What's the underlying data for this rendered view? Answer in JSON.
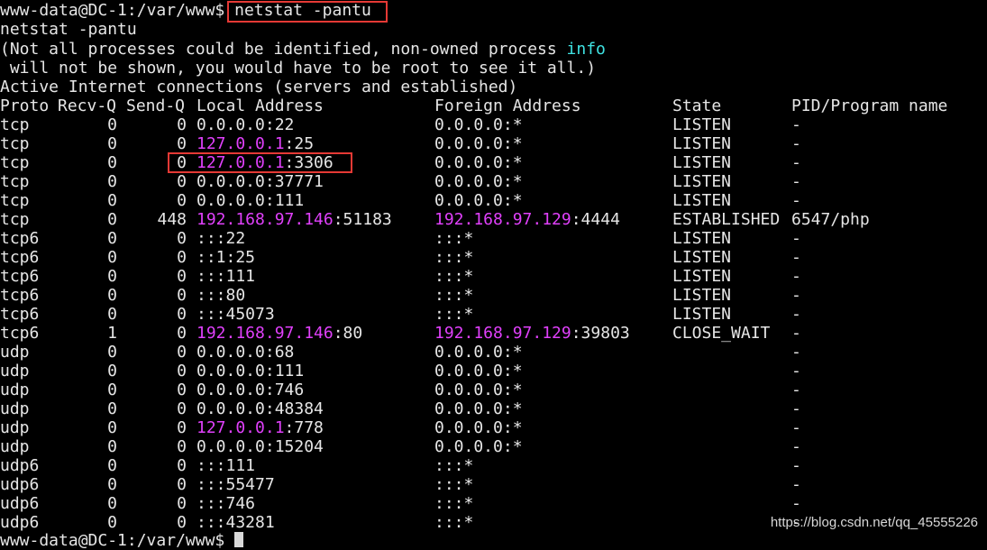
{
  "prompt": {
    "user_host": "www-data@DC-1",
    "path_sep": ":/var/www$",
    "command": "netstat -pantu"
  },
  "echo": "netstat -pantu",
  "notice": {
    "line1_pre": "(Not all processes could be identified, non-owned process ",
    "line1_kw": "info",
    "line2": " will not be shown, you would have to be root to see it all.)"
  },
  "section_title": "Active Internet connections (servers and established)",
  "headers": {
    "proto": "Proto",
    "recvq": "Recv-Q",
    "sendq": "Send-Q",
    "local": "Local Address",
    "foreign": "Foreign Address",
    "state": "State",
    "pid": "PID/Program name"
  },
  "rows": [
    {
      "proto": "tcp",
      "recvq": "0",
      "sendq": "0",
      "local_ip": "0.0.0.0",
      "local_port": ":22",
      "local_colored": false,
      "foreign_ip": "0.0.0.0",
      "foreign_port": ":*",
      "foreign_colored": false,
      "state": "LISTEN",
      "pid": "-"
    },
    {
      "proto": "tcp",
      "recvq": "0",
      "sendq": "0",
      "local_ip": "127.0.0.1",
      "local_port": ":25",
      "local_colored": true,
      "foreign_ip": "0.0.0.0",
      "foreign_port": ":*",
      "foreign_colored": false,
      "state": "LISTEN",
      "pid": "-"
    },
    {
      "proto": "tcp",
      "recvq": "0",
      "sendq": "0",
      "local_ip": "127.0.0.1",
      "local_port": ":3306",
      "local_colored": true,
      "foreign_ip": "0.0.0.0",
      "foreign_port": ":*",
      "foreign_colored": false,
      "state": "LISTEN",
      "pid": "-"
    },
    {
      "proto": "tcp",
      "recvq": "0",
      "sendq": "0",
      "local_ip": "0.0.0.0",
      "local_port": ":37771",
      "local_colored": false,
      "foreign_ip": "0.0.0.0",
      "foreign_port": ":*",
      "foreign_colored": false,
      "state": "LISTEN",
      "pid": "-"
    },
    {
      "proto": "tcp",
      "recvq": "0",
      "sendq": "0",
      "local_ip": "0.0.0.0",
      "local_port": ":111",
      "local_colored": false,
      "foreign_ip": "0.0.0.0",
      "foreign_port": ":*",
      "foreign_colored": false,
      "state": "LISTEN",
      "pid": "-"
    },
    {
      "proto": "tcp",
      "recvq": "0",
      "sendq": "448",
      "local_ip": "192.168.97.146",
      "local_port": ":51183",
      "local_colored": true,
      "foreign_ip": "192.168.97.129",
      "foreign_port": ":4444",
      "foreign_colored": true,
      "state": "ESTABLISHED",
      "pid": "6547/php"
    },
    {
      "proto": "tcp6",
      "recvq": "0",
      "sendq": "0",
      "local_ip": ":::22",
      "local_port": "",
      "local_colored": false,
      "foreign_ip": ":::*",
      "foreign_port": "",
      "foreign_colored": false,
      "state": "LISTEN",
      "pid": "-"
    },
    {
      "proto": "tcp6",
      "recvq": "0",
      "sendq": "0",
      "local_ip": "::1:25",
      "local_port": "",
      "local_colored": false,
      "foreign_ip": ":::*",
      "foreign_port": "",
      "foreign_colored": false,
      "state": "LISTEN",
      "pid": "-"
    },
    {
      "proto": "tcp6",
      "recvq": "0",
      "sendq": "0",
      "local_ip": ":::111",
      "local_port": "",
      "local_colored": false,
      "foreign_ip": ":::*",
      "foreign_port": "",
      "foreign_colored": false,
      "state": "LISTEN",
      "pid": "-"
    },
    {
      "proto": "tcp6",
      "recvq": "0",
      "sendq": "0",
      "local_ip": ":::80",
      "local_port": "",
      "local_colored": false,
      "foreign_ip": ":::*",
      "foreign_port": "",
      "foreign_colored": false,
      "state": "LISTEN",
      "pid": "-"
    },
    {
      "proto": "tcp6",
      "recvq": "0",
      "sendq": "0",
      "local_ip": ":::45073",
      "local_port": "",
      "local_colored": false,
      "foreign_ip": ":::*",
      "foreign_port": "",
      "foreign_colored": false,
      "state": "LISTEN",
      "pid": "-"
    },
    {
      "proto": "tcp6",
      "recvq": "1",
      "sendq": "0",
      "local_ip": "192.168.97.146",
      "local_port": ":80",
      "local_colored": true,
      "foreign_ip": "192.168.97.129",
      "foreign_port": ":39803",
      "foreign_colored": true,
      "state": "CLOSE_WAIT",
      "pid": "-"
    },
    {
      "proto": "udp",
      "recvq": "0",
      "sendq": "0",
      "local_ip": "0.0.0.0",
      "local_port": ":68",
      "local_colored": false,
      "foreign_ip": "0.0.0.0",
      "foreign_port": ":*",
      "foreign_colored": false,
      "state": "",
      "pid": "-"
    },
    {
      "proto": "udp",
      "recvq": "0",
      "sendq": "0",
      "local_ip": "0.0.0.0",
      "local_port": ":111",
      "local_colored": false,
      "foreign_ip": "0.0.0.0",
      "foreign_port": ":*",
      "foreign_colored": false,
      "state": "",
      "pid": "-"
    },
    {
      "proto": "udp",
      "recvq": "0",
      "sendq": "0",
      "local_ip": "0.0.0.0",
      "local_port": ":746",
      "local_colored": false,
      "foreign_ip": "0.0.0.0",
      "foreign_port": ":*",
      "foreign_colored": false,
      "state": "",
      "pid": "-"
    },
    {
      "proto": "udp",
      "recvq": "0",
      "sendq": "0",
      "local_ip": "0.0.0.0",
      "local_port": ":48384",
      "local_colored": false,
      "foreign_ip": "0.0.0.0",
      "foreign_port": ":*",
      "foreign_colored": false,
      "state": "",
      "pid": "-"
    },
    {
      "proto": "udp",
      "recvq": "0",
      "sendq": "0",
      "local_ip": "127.0.0.1",
      "local_port": ":778",
      "local_colored": true,
      "foreign_ip": "0.0.0.0",
      "foreign_port": ":*",
      "foreign_colored": false,
      "state": "",
      "pid": "-"
    },
    {
      "proto": "udp",
      "recvq": "0",
      "sendq": "0",
      "local_ip": "0.0.0.0",
      "local_port": ":15204",
      "local_colored": false,
      "foreign_ip": "0.0.0.0",
      "foreign_port": ":*",
      "foreign_colored": false,
      "state": "",
      "pid": "-"
    },
    {
      "proto": "udp6",
      "recvq": "0",
      "sendq": "0",
      "local_ip": ":::111",
      "local_port": "",
      "local_colored": false,
      "foreign_ip": ":::*",
      "foreign_port": "",
      "foreign_colored": false,
      "state": "",
      "pid": "-"
    },
    {
      "proto": "udp6",
      "recvq": "0",
      "sendq": "0",
      "local_ip": ":::55477",
      "local_port": "",
      "local_colored": false,
      "foreign_ip": ":::*",
      "foreign_port": "",
      "foreign_colored": false,
      "state": "",
      "pid": "-"
    },
    {
      "proto": "udp6",
      "recvq": "0",
      "sendq": "0",
      "local_ip": ":::746",
      "local_port": "",
      "local_colored": false,
      "foreign_ip": ":::*",
      "foreign_port": "",
      "foreign_colored": false,
      "state": "",
      "pid": "-"
    },
    {
      "proto": "udp6",
      "recvq": "0",
      "sendq": "0",
      "local_ip": ":::43281",
      "local_port": "",
      "local_colored": false,
      "foreign_ip": ":::*",
      "foreign_port": "",
      "foreign_colored": false,
      "state": "",
      "pid": "-"
    }
  ],
  "bottom_prompt": "www-data@DC-1:/var/www$ ",
  "watermark": "https://blog.csdn.net/qq_45555226",
  "colors": {
    "background": "#000000",
    "foreground": "#e6e6e6",
    "ip_magenta": "#e040fb",
    "keyword_cyan": "#3fe3e3",
    "highlight_red": "#e53935"
  }
}
